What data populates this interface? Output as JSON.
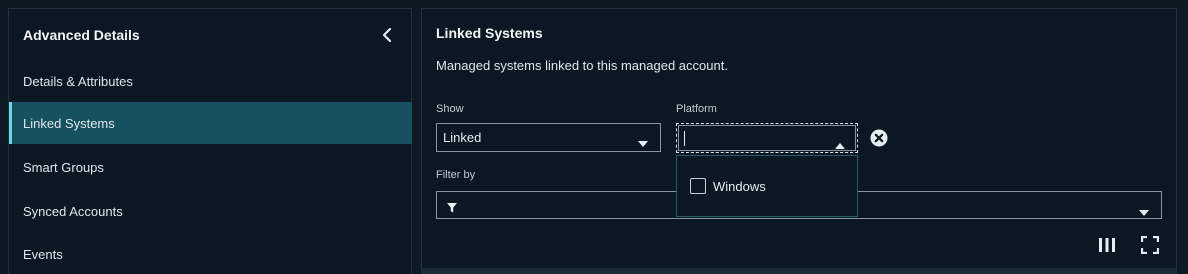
{
  "sidebar": {
    "title": "Advanced Details",
    "items": [
      {
        "label": "Details & Attributes",
        "active": false
      },
      {
        "label": "Linked Systems",
        "active": true
      },
      {
        "label": "Smart Groups",
        "active": false
      },
      {
        "label": "Synced Accounts",
        "active": false
      },
      {
        "label": "Events",
        "active": false
      }
    ]
  },
  "main": {
    "title": "Linked Systems",
    "description": "Managed systems linked to this managed account.",
    "show": {
      "label": "Show",
      "value": "Linked"
    },
    "platform": {
      "label": "Platform",
      "value": "",
      "options": [
        {
          "label": "Windows",
          "checked": false
        }
      ]
    },
    "filter": {
      "label": "Filter by",
      "value": ""
    }
  },
  "icons": {
    "collapse": "chevron-left-icon",
    "caret_down": "caret-down-icon",
    "caret_up": "caret-up-icon",
    "clear": "clear-circle-icon",
    "filter": "filter-funnel-icon",
    "columns": "columns-icon",
    "fullscreen": "fullscreen-icon"
  },
  "colors": {
    "background": "#0d1a24",
    "panel": "#0b1722",
    "active_item": "#17515f",
    "active_accent": "#6fd5e0",
    "border": "#8a969f"
  }
}
